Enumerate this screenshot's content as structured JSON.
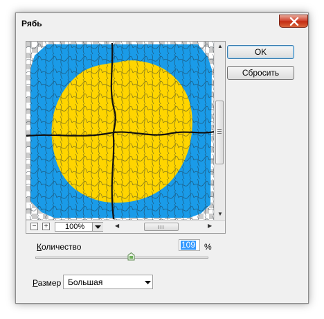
{
  "window": {
    "title": "Рябь"
  },
  "buttons": {
    "ok": "OK",
    "reset": "Сбросить"
  },
  "preview": {
    "zoom_value": "100%",
    "zoom_out": "−",
    "zoom_in": "+",
    "colors": {
      "outer": "#1a9be8",
      "inner": "#ffd500",
      "crack": "#111111"
    }
  },
  "amount": {
    "label": "Количество",
    "value": "109",
    "unit": "%",
    "slider_fraction": 0.55
  },
  "size": {
    "label": "Размер",
    "value": "Большая"
  },
  "icons": {
    "close": "close-icon",
    "dropdown": "chevron-down-icon"
  }
}
